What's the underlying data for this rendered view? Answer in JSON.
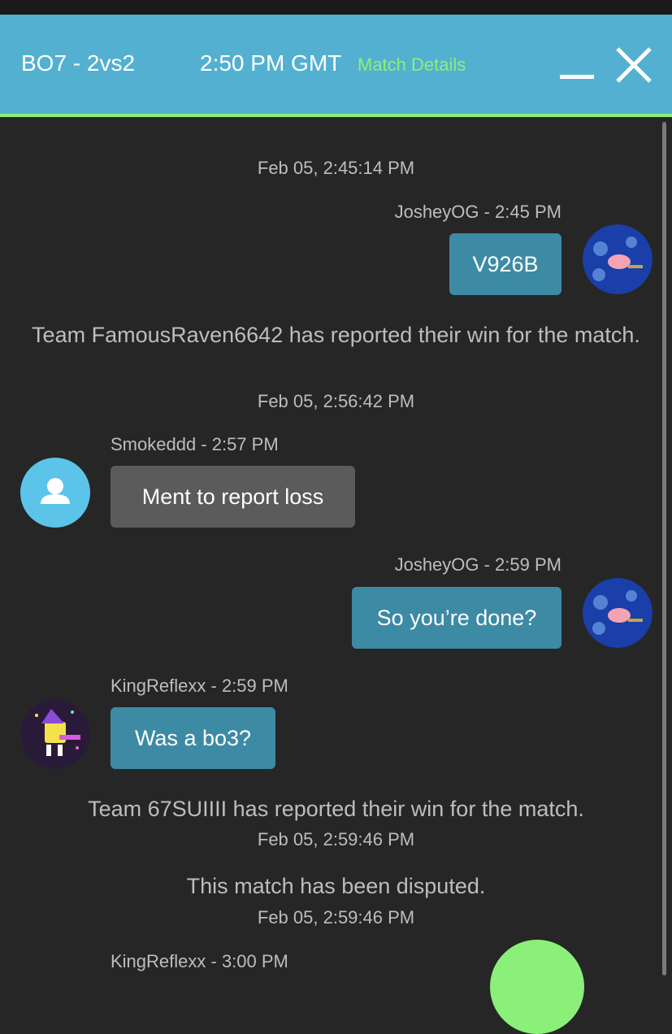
{
  "header": {
    "title": "BO7 - 2vs2",
    "time": "2:50 PM GMT",
    "details_link": "Match Details"
  },
  "messages": [
    {
      "kind": "timestamp",
      "text": "Feb 05, 2:45:14 PM"
    },
    {
      "kind": "message",
      "side": "right",
      "sender": "JosheyOG - 2:45 PM",
      "text": "V926B",
      "avatar": "patrick-avatar"
    },
    {
      "kind": "system",
      "text": "Team FamousRaven6642 has reported their win for the match.",
      "time": "Feb 05, 2:56:42 PM"
    },
    {
      "kind": "message",
      "side": "left",
      "sender": "Smokeddd - 2:57 PM",
      "text": "Ment to report loss",
      "avatar": "default-user-avatar"
    },
    {
      "kind": "message",
      "side": "right",
      "sender": "JosheyOG - 2:59 PM",
      "text": "So you’re done?",
      "avatar": "patrick-avatar"
    },
    {
      "kind": "message",
      "side": "left",
      "sender": "KingReflexx - 2:59 PM",
      "text": "Was a bo3?",
      "avatar": "spongebob-avatar"
    },
    {
      "kind": "system",
      "text": "Team 67SUIIII has reported their win for the match.",
      "time": "Feb 05, 2:59:46 PM"
    },
    {
      "kind": "system",
      "text": "This match has been disputed.",
      "time": "Feb 05, 2:59:46 PM"
    },
    {
      "kind": "message",
      "side": "left",
      "sender": "KingReflexx - 3:00 PM",
      "text": "",
      "avatar": "spongebob-avatar"
    }
  ],
  "colors": {
    "header_bg": "#54b0d0",
    "accent_green": "#8bf07a",
    "bubble_blue": "#3d8aa5",
    "bubble_gray": "#5b5b5b",
    "background": "#262626"
  }
}
